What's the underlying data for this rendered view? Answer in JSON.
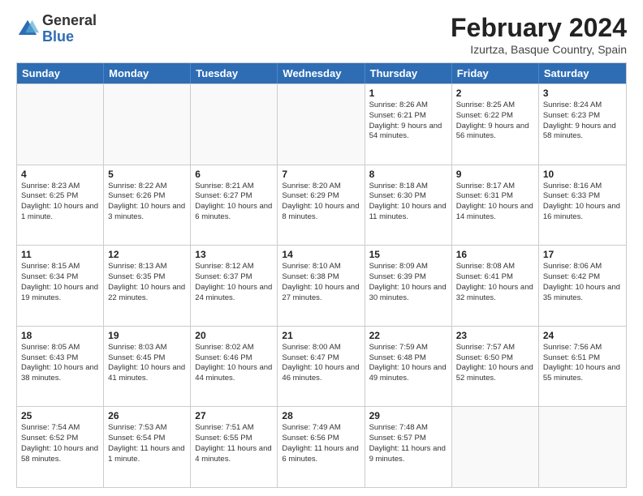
{
  "logo": {
    "general": "General",
    "blue": "Blue"
  },
  "title": "February 2024",
  "subtitle": "Izurtza, Basque Country, Spain",
  "header_days": [
    "Sunday",
    "Monday",
    "Tuesday",
    "Wednesday",
    "Thursday",
    "Friday",
    "Saturday"
  ],
  "weeks": [
    [
      {
        "day": "",
        "info": ""
      },
      {
        "day": "",
        "info": ""
      },
      {
        "day": "",
        "info": ""
      },
      {
        "day": "",
        "info": ""
      },
      {
        "day": "1",
        "info": "Sunrise: 8:26 AM\nSunset: 6:21 PM\nDaylight: 9 hours and 54 minutes."
      },
      {
        "day": "2",
        "info": "Sunrise: 8:25 AM\nSunset: 6:22 PM\nDaylight: 9 hours and 56 minutes."
      },
      {
        "day": "3",
        "info": "Sunrise: 8:24 AM\nSunset: 6:23 PM\nDaylight: 9 hours and 58 minutes."
      }
    ],
    [
      {
        "day": "4",
        "info": "Sunrise: 8:23 AM\nSunset: 6:25 PM\nDaylight: 10 hours and 1 minute."
      },
      {
        "day": "5",
        "info": "Sunrise: 8:22 AM\nSunset: 6:26 PM\nDaylight: 10 hours and 3 minutes."
      },
      {
        "day": "6",
        "info": "Sunrise: 8:21 AM\nSunset: 6:27 PM\nDaylight: 10 hours and 6 minutes."
      },
      {
        "day": "7",
        "info": "Sunrise: 8:20 AM\nSunset: 6:29 PM\nDaylight: 10 hours and 8 minutes."
      },
      {
        "day": "8",
        "info": "Sunrise: 8:18 AM\nSunset: 6:30 PM\nDaylight: 10 hours and 11 minutes."
      },
      {
        "day": "9",
        "info": "Sunrise: 8:17 AM\nSunset: 6:31 PM\nDaylight: 10 hours and 14 minutes."
      },
      {
        "day": "10",
        "info": "Sunrise: 8:16 AM\nSunset: 6:33 PM\nDaylight: 10 hours and 16 minutes."
      }
    ],
    [
      {
        "day": "11",
        "info": "Sunrise: 8:15 AM\nSunset: 6:34 PM\nDaylight: 10 hours and 19 minutes."
      },
      {
        "day": "12",
        "info": "Sunrise: 8:13 AM\nSunset: 6:35 PM\nDaylight: 10 hours and 22 minutes."
      },
      {
        "day": "13",
        "info": "Sunrise: 8:12 AM\nSunset: 6:37 PM\nDaylight: 10 hours and 24 minutes."
      },
      {
        "day": "14",
        "info": "Sunrise: 8:10 AM\nSunset: 6:38 PM\nDaylight: 10 hours and 27 minutes."
      },
      {
        "day": "15",
        "info": "Sunrise: 8:09 AM\nSunset: 6:39 PM\nDaylight: 10 hours and 30 minutes."
      },
      {
        "day": "16",
        "info": "Sunrise: 8:08 AM\nSunset: 6:41 PM\nDaylight: 10 hours and 32 minutes."
      },
      {
        "day": "17",
        "info": "Sunrise: 8:06 AM\nSunset: 6:42 PM\nDaylight: 10 hours and 35 minutes."
      }
    ],
    [
      {
        "day": "18",
        "info": "Sunrise: 8:05 AM\nSunset: 6:43 PM\nDaylight: 10 hours and 38 minutes."
      },
      {
        "day": "19",
        "info": "Sunrise: 8:03 AM\nSunset: 6:45 PM\nDaylight: 10 hours and 41 minutes."
      },
      {
        "day": "20",
        "info": "Sunrise: 8:02 AM\nSunset: 6:46 PM\nDaylight: 10 hours and 44 minutes."
      },
      {
        "day": "21",
        "info": "Sunrise: 8:00 AM\nSunset: 6:47 PM\nDaylight: 10 hours and 46 minutes."
      },
      {
        "day": "22",
        "info": "Sunrise: 7:59 AM\nSunset: 6:48 PM\nDaylight: 10 hours and 49 minutes."
      },
      {
        "day": "23",
        "info": "Sunrise: 7:57 AM\nSunset: 6:50 PM\nDaylight: 10 hours and 52 minutes."
      },
      {
        "day": "24",
        "info": "Sunrise: 7:56 AM\nSunset: 6:51 PM\nDaylight: 10 hours and 55 minutes."
      }
    ],
    [
      {
        "day": "25",
        "info": "Sunrise: 7:54 AM\nSunset: 6:52 PM\nDaylight: 10 hours and 58 minutes."
      },
      {
        "day": "26",
        "info": "Sunrise: 7:53 AM\nSunset: 6:54 PM\nDaylight: 11 hours and 1 minute."
      },
      {
        "day": "27",
        "info": "Sunrise: 7:51 AM\nSunset: 6:55 PM\nDaylight: 11 hours and 4 minutes."
      },
      {
        "day": "28",
        "info": "Sunrise: 7:49 AM\nSunset: 6:56 PM\nDaylight: 11 hours and 6 minutes."
      },
      {
        "day": "29",
        "info": "Sunrise: 7:48 AM\nSunset: 6:57 PM\nDaylight: 11 hours and 9 minutes."
      },
      {
        "day": "",
        "info": ""
      },
      {
        "day": "",
        "info": ""
      }
    ]
  ]
}
